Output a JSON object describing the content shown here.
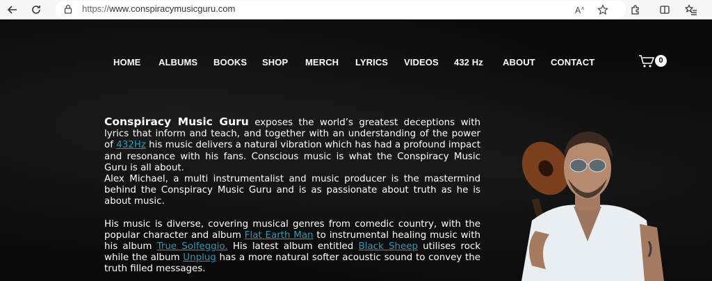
{
  "browser": {
    "url_proto": "https://",
    "url_host": "www.conspiracymusicguru.com",
    "back_icon": "back-arrow-icon",
    "reload_icon": "reload-icon"
  },
  "nav": {
    "items": [
      "HOME",
      "ALBUMS",
      "BOOKS",
      "SHOP",
      "MERCH",
      "LYRICS",
      "VIDEOS",
      "432 Hz",
      "ABOUT",
      "CONTACT"
    ]
  },
  "cart": {
    "count": "0"
  },
  "content": {
    "brand": "Conspiracy Music Guru",
    "p1_a": " exposes the world’s greatest deceptions with lyrics that inform and teach, and together with an understanding of the power of ",
    "link_432": "432Hz",
    "p1_b": " his music delivers a natural vibration which has had a profound impact and resonance with his fans. Conscious music is what the Conspiracy Music Guru is all about.",
    "p2": "Alex Michael, a multi instrumentalist and music producer is the mastermind behind the Conspiracy Music Guru and is as passionate about truth as he is about music.",
    "p3_a": "His music is diverse, covering musical genres from comedic country, with the popular character and album ",
    "link_flat": "Flat Earth Man",
    "p3_b": " to instrumental healing music with his album ",
    "link_true": "True Solfeggio.",
    "p3_c": " His latest album entitled ",
    "link_black": "Black Sheep",
    "p3_d": " utilises rock while the album ",
    "link_unplug": "Unplug",
    "p3_e": " has a more natural softer acoustic sound to convey the truth filled messages."
  },
  "colors": {
    "link": "#2a9ab8",
    "background": "#0a0a0a"
  }
}
